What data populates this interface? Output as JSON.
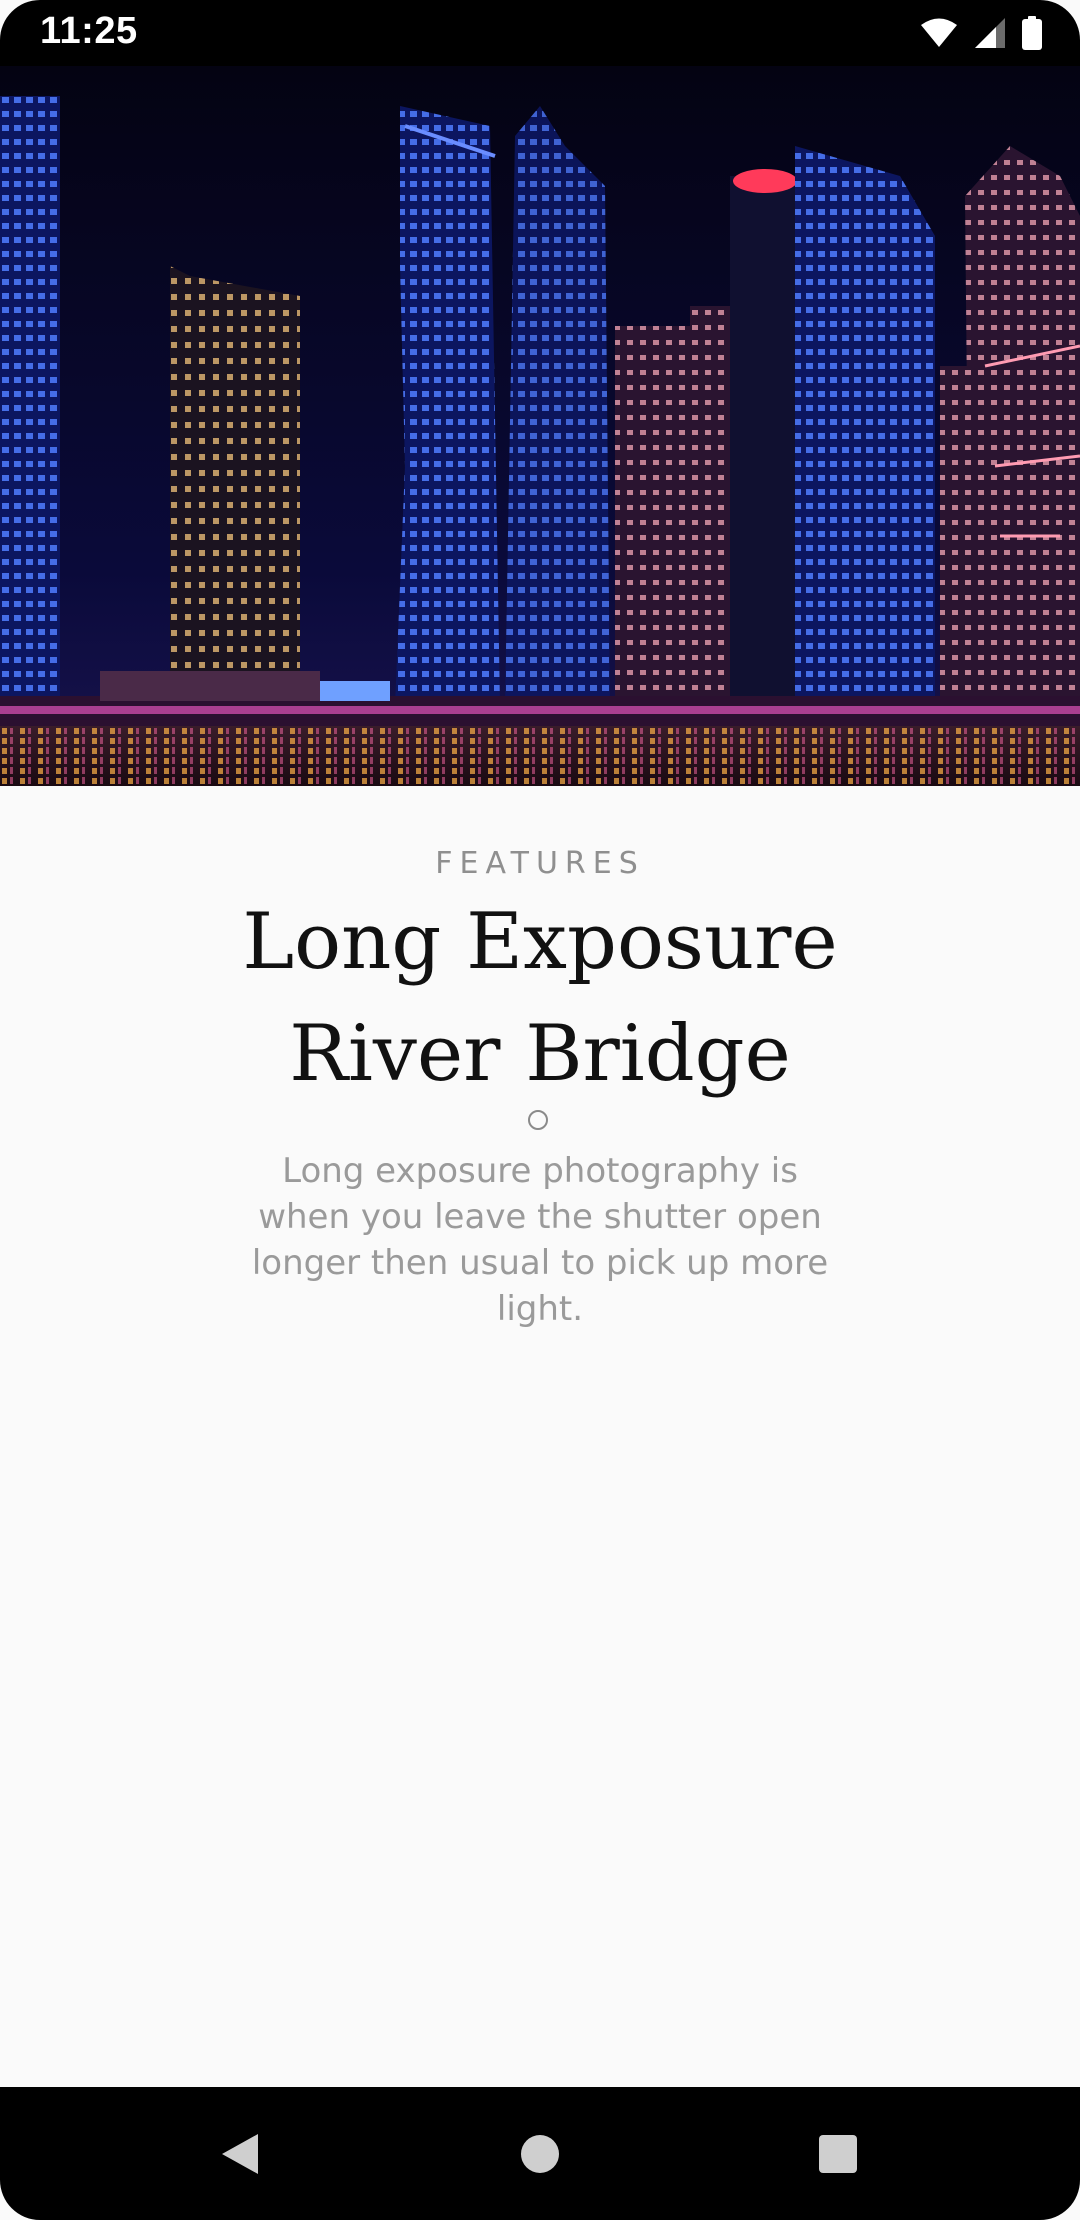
{
  "status_bar": {
    "time": "11:25",
    "icons": [
      "wifi-icon",
      "cellular-signal-icon",
      "battery-icon"
    ]
  },
  "hero": {
    "image": "night-city-skyline-photo"
  },
  "feature": {
    "overline": "FEATURES",
    "title_line1": "Long Exposure",
    "title_line2": "River Bridge",
    "divider_icon": "circle-ring-icon",
    "description": "Long exposure photography is when you leave the shutter open longer then usual to pick up more light."
  },
  "navigation": {
    "back_icon": "back-triangle-icon",
    "home_icon": "home-circle-icon",
    "recents_icon": "recents-square-icon"
  },
  "colors": {
    "background": "#fafafa",
    "bars": "#000000",
    "title": "#111111",
    "secondary_text": "#9a9a9a"
  }
}
